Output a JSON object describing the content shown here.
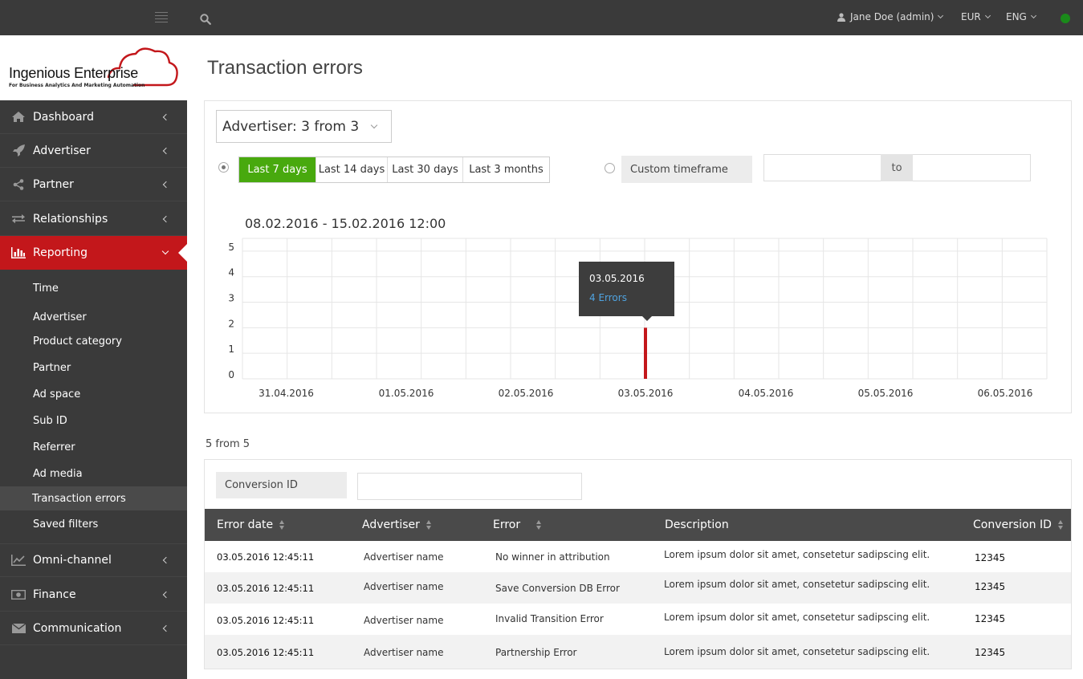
{
  "topbar": {
    "user": "Jane Doe (admin)",
    "currency": "EUR",
    "language": "ENG",
    "status_color": "#1a8a1a"
  },
  "logo": {
    "name": "Ingenious Enterprise",
    "tagline": "For Business Analytics And Marketing Automation"
  },
  "sidebar": {
    "items": [
      {
        "label": "Dashboard",
        "icon": "home-icon"
      },
      {
        "label": "Advertiser",
        "icon": "rocket-icon"
      },
      {
        "label": "Partner",
        "icon": "share-icon"
      },
      {
        "label": "Relationships",
        "icon": "exchange-icon"
      },
      {
        "label": "Reporting",
        "icon": "bar-chart-icon",
        "active": true
      },
      {
        "label": "Omni-channel",
        "icon": "line-chart-icon"
      },
      {
        "label": "Finance",
        "icon": "money-icon"
      },
      {
        "label": "Communication",
        "icon": "envelope-icon"
      }
    ],
    "reporting_sub": [
      "Time",
      "Advertiser",
      "Product category",
      "Partner",
      "Ad space",
      "Sub ID",
      "Referrer",
      "Ad media",
      "Transaction errors",
      "Saved filters"
    ],
    "accent_color": "#c3171b"
  },
  "page": {
    "title": "Transaction errors"
  },
  "filters": {
    "advertiser_dropdown": "Advertiser: 3 from 3",
    "ranges": [
      "Last 7 days",
      "Last 14 days",
      "Last 30 days",
      "Last 3 months"
    ],
    "active_range": "Last 7 days",
    "custom_timeframe": "Custom timeframe",
    "to_label": "to",
    "active_color": "#48a90e"
  },
  "chart": {
    "title": "08.02.2016 - 15.02.2016  12:00",
    "tooltip": {
      "date": "03.05.2016",
      "value": "4 Errors"
    }
  },
  "chart_data": {
    "type": "bar",
    "title": "08.02.2016 - 15.02.2016  12:00",
    "x": [
      "31.04.2016",
      "01.05.2016",
      "02.05.2016",
      "03.05.2016",
      "04.05.2016",
      "05.05.2016",
      "06.05.2016"
    ],
    "series": [
      {
        "values": [
          0,
          0,
          0,
          2,
          0,
          0,
          0
        ]
      }
    ],
    "ylim": [
      0,
      5.5
    ],
    "yticks": [
      0,
      1,
      2,
      3,
      4,
      5
    ],
    "grid": true,
    "bar_color": "#c3171b"
  },
  "table": {
    "count": "5 from 5",
    "filter_label": "Conversion ID",
    "headers": [
      "Error date",
      "Advertiser",
      "Error",
      "Description",
      "Conversion ID"
    ],
    "rows": [
      {
        "date": "03.05.2016  12:45:11",
        "advertiser": "Advertiser name",
        "error": "No winner in  attribution",
        "description": "Lorem ipsum dolor sit amet, consetetur sadipscing elit.",
        "conversion_id": "12345"
      },
      {
        "date": "03.05.2016  12:45:11",
        "advertiser": "Advertiser name",
        "error": "Save Conversion DB Error",
        "description": "Lorem ipsum dolor sit amet, consetetur sadipscing elit.",
        "conversion_id": "12345"
      },
      {
        "date": "03.05.2016  12:45:11",
        "advertiser": "Advertiser name",
        "error": "Invalid Transition Error",
        "description": "Lorem ipsum dolor sit amet, consetetur sadipscing elit.",
        "conversion_id": "12345"
      },
      {
        "date": "03.05.2016  12:45:11",
        "advertiser": "Advertiser name",
        "error": "Partnership Error",
        "description": "Lorem ipsum dolor sit amet, consetetur sadipscing elit.",
        "conversion_id": "12345"
      }
    ]
  }
}
